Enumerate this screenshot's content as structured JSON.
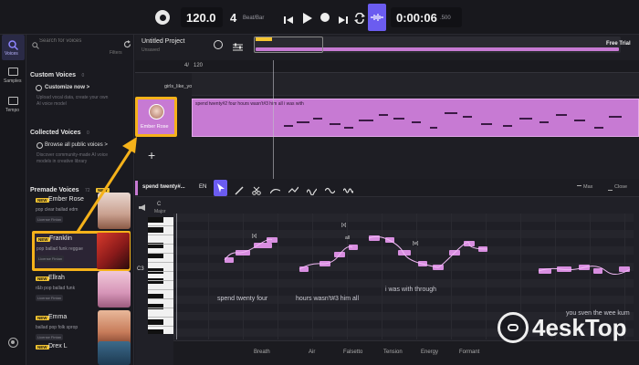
{
  "toolbar": {
    "tempo": "120.0",
    "beats": "4",
    "time_sig_label": "Beat/Bar",
    "timecode": "0:00:06",
    "timecode_ms": ".500"
  },
  "project": {
    "title": "Untitled Project",
    "subtitle": "Unsaved",
    "free_trial": "Free Trial"
  },
  "nav": {
    "voices": "Voices",
    "samples": "Samples",
    "tempo": "Tempo"
  },
  "voice_panel": {
    "search_placeholder": "Search for voices",
    "filters": "Filters",
    "custom_header": "Custom Voices",
    "custom_count": "0",
    "customize": "Customize now >",
    "custom_desc1": "Upload vocal data, create your own",
    "custom_desc2": "AI voice model",
    "collected_header": "Collected Voices",
    "collected_count": "0",
    "browse": "Browse all public voices >",
    "browse_desc1": "Discover community-made AI voice",
    "browse_desc2": "models in creative library",
    "premade_header": "Premade Voices",
    "premade_count": "72",
    "new_badge": "NEW",
    "voices": [
      {
        "name": "Ember Rose",
        "desc": "pop clear ballad edm",
        "lic": "License Fintan"
      },
      {
        "name": "Franklin",
        "desc": "pop ballad funk reggae",
        "lic": "License Fintan"
      },
      {
        "name": "Ellrah",
        "desc": "r&b pop ballad funk",
        "lic": "License Fintan"
      },
      {
        "name": "Emma",
        "desc": "ballad pop folk sprop",
        "lic": "License Fintan"
      },
      {
        "name": "Drex L",
        "desc": "",
        "lic": ""
      }
    ]
  },
  "tracks": {
    "ruler_value": "4/",
    "ruler_value2": "120",
    "track_name": "girls_like_you",
    "singer": "Ember Rose",
    "clip_lyric": "spend twenty#2 four hours wasn't#3 him all i was with"
  },
  "editor": {
    "clip_name": "spend twenty#...",
    "lang": "EN",
    "key_label": "C",
    "key_mode": "Major",
    "c3": "C3",
    "max": "Max",
    "close": "Close",
    "lyrics": [
      "spend twenty four",
      "hours wasn't#3 him all",
      "i was with through",
      "you sven the wee kum"
    ],
    "note_labels": [
      "[x]",
      "[x]",
      "all",
      "[w]"
    ],
    "params": [
      "Breath",
      "Air",
      "Falsetto",
      "Tension",
      "Energy",
      "Formant"
    ]
  },
  "watermark": {
    "text": "4eskTop"
  },
  "colors": {
    "accent": "#6b5cf0",
    "clip": "#c77ad3",
    "highlight": "#f5b21a",
    "note": "#d88ee0"
  }
}
